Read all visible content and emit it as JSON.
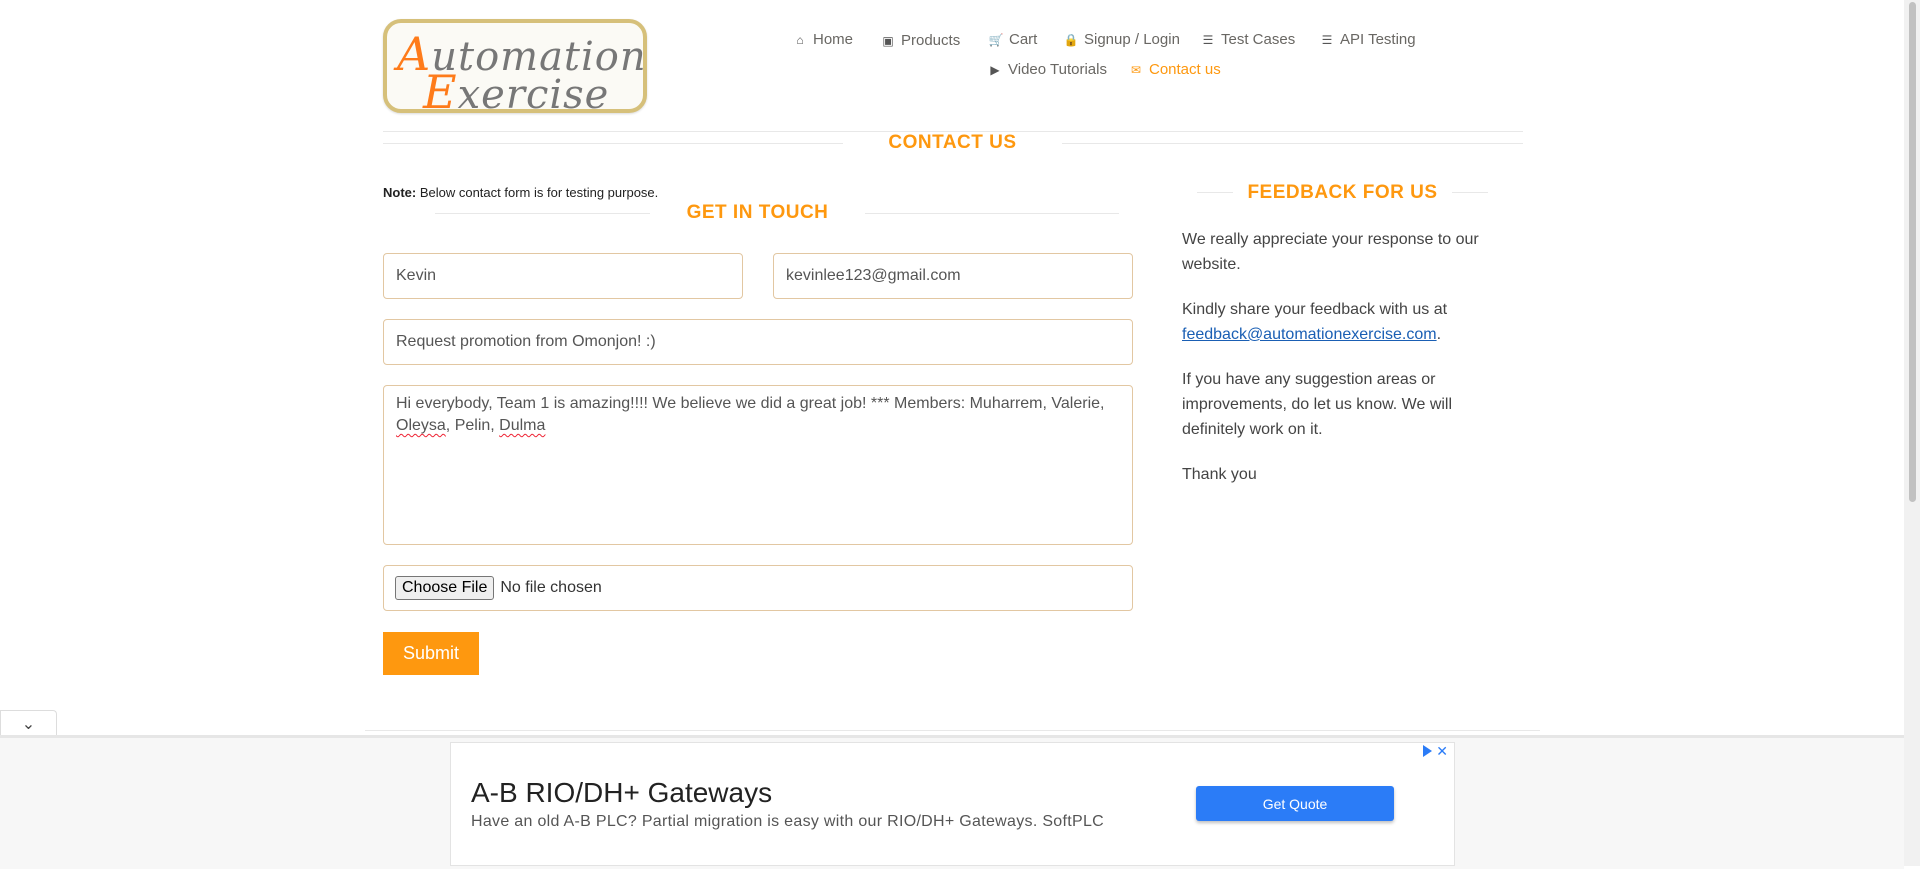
{
  "logo": {
    "line1": "utomation",
    "line1_cap": "A",
    "line2": "xercise",
    "line2_cap": "E"
  },
  "nav": [
    {
      "label": "Home",
      "icon": "home-icon",
      "glyph": "⌂"
    },
    {
      "label": "Products",
      "icon": "products-icon",
      "glyph": "▣"
    },
    {
      "label": "Cart",
      "icon": "cart-icon",
      "glyph": "🛒"
    },
    {
      "label": "Signup / Login",
      "icon": "lock-icon",
      "glyph": "🔒"
    },
    {
      "label": "Test Cases",
      "icon": "list-icon",
      "glyph": "☰"
    },
    {
      "label": "API Testing",
      "icon": "list-icon",
      "glyph": "☰"
    },
    {
      "label": "Video Tutorials",
      "icon": "youtube-icon",
      "glyph": "▶"
    },
    {
      "label": "Contact us",
      "icon": "envelope-icon",
      "glyph": "✉"
    }
  ],
  "contact": {
    "title": "CONTACT US",
    "note_bold": "Note:",
    "note_text": " Below contact form is for testing purpose.",
    "get_in_touch": "GET IN TOUCH"
  },
  "form": {
    "name": "Kevin",
    "email": "kevinlee123@gmail.com",
    "subject": "Request promotion from Omonjon! :)",
    "message_a": "Hi everybody, Team 1 is amazing!!!! We believe we did a great job! *** Members: Muharrem, Valerie,",
    "message_w1": "Oleysa",
    "message_b": ", Pelin, ",
    "message_w2": "Dulma",
    "file_button": "Choose File",
    "file_status": "No file chosen",
    "submit": "Submit"
  },
  "feedback": {
    "title": "FEEDBACK FOR US",
    "p1": "We really appreciate your response to our website.",
    "p2_text": "Kindly share your feedback with us at ",
    "p2_link": "feedback@automationexercise.com",
    "p2_end": ".",
    "p3": "If you have any suggestion areas or improvements, do let us know. We will definitely work on it.",
    "p4": "Thank you"
  },
  "ad": {
    "title": "A-B RIO/DH+ Gateways",
    "description": "Have an old A-B PLC? Partial migration is easy with our RIO/DH+ Gateways. SoftPLC",
    "button": "Get Quote",
    "close": "✕"
  },
  "colors": {
    "accent": "#fe980f",
    "ad_button": "#2b7cf7",
    "link": "#1a5fb4"
  }
}
